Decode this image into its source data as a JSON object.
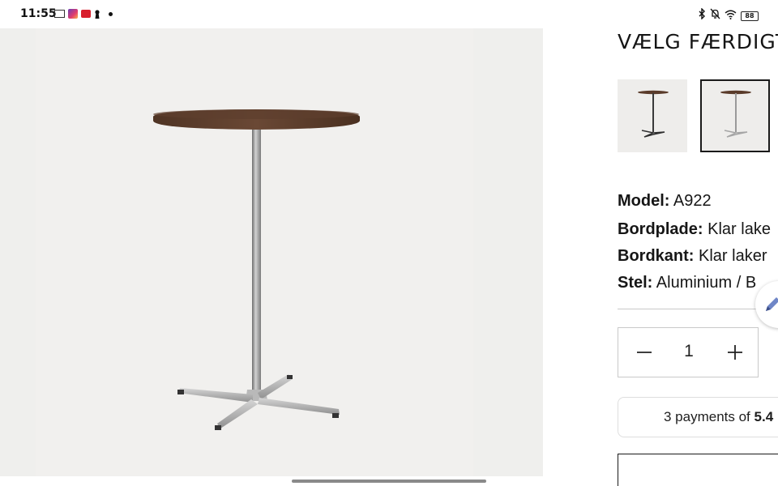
{
  "status_bar": {
    "time": "11:55",
    "battery": "88",
    "notification_icons": [
      "news-icon",
      "photo-app-icon",
      "red-app-icon",
      "keyhole-icon",
      "dot-icon"
    ],
    "system_icons": [
      "bluetooth-icon",
      "bell-off-icon",
      "wifi-icon",
      "battery-icon"
    ]
  },
  "product": {
    "heading": "VÆLG FÆRDIGT",
    "thumbnails": [
      {
        "name": "table-dark-frame",
        "selected": false
      },
      {
        "name": "table-aluminium-frame",
        "selected": true
      }
    ],
    "specs": [
      {
        "label": "Model:",
        "value": "A922"
      },
      {
        "label": "Bordplade:",
        "value": "Klar lake"
      },
      {
        "label": "Bordkant:",
        "value": "Klar laker"
      },
      {
        "label": "Stel:",
        "value": "Aluminium / B"
      }
    ]
  },
  "quantity": {
    "value": "1",
    "minus_icon": "minus-icon",
    "plus_icon": "plus-icon"
  },
  "payments": {
    "text": "3 payments of ",
    "amount": "5.4"
  },
  "colors": {
    "image_background": "#efefed",
    "tabletop": "#5a3b2a",
    "frame": "#9a9a9a",
    "text": "#1a1a1a"
  }
}
